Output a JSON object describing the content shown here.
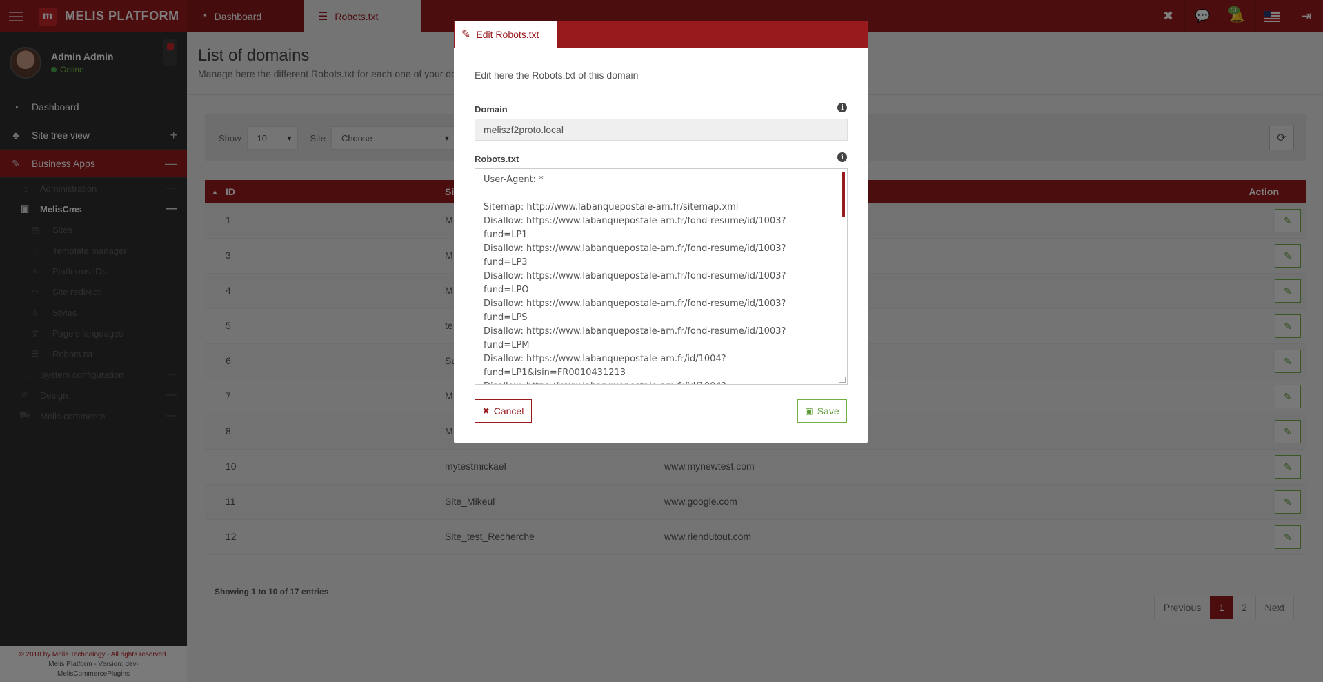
{
  "topbar": {
    "brand": "MELIS PLATFORM",
    "brand_logo": "m",
    "tabs": [
      {
        "label": "Dashboard",
        "icon": "dashboard-icon"
      },
      {
        "label": "Robots.txt",
        "icon": "server-icon"
      }
    ],
    "notification_count": "51"
  },
  "sidebar": {
    "user_name": "Admin Admin",
    "user_status": "Online",
    "items": [
      {
        "label": "Dashboard",
        "icon": "dashboard-icon"
      },
      {
        "label": "Site tree view",
        "icon": "sitemap-icon",
        "toggle": "+"
      },
      {
        "label": "Business Apps",
        "icon": "wrench-icon",
        "toggle": "—"
      }
    ],
    "sub_items": [
      {
        "label": "Administration",
        "icon": "bank-icon",
        "toggle": "—"
      },
      {
        "label": "MelisCms",
        "icon": "id-card-icon",
        "toggle": "—"
      }
    ],
    "cms_items": [
      {
        "label": "Sites",
        "icon": "book-icon"
      },
      {
        "label": "Template manager",
        "icon": "file-icon"
      },
      {
        "label": "Platforms IDs",
        "icon": "list-icon"
      },
      {
        "label": "Site redirect",
        "icon": "share-icon"
      },
      {
        "label": "Styles",
        "icon": "css-icon"
      },
      {
        "label": "Page's languages",
        "icon": "language-icon"
      },
      {
        "label": "Robots.txt",
        "icon": "server-icon"
      }
    ],
    "bottom_items": [
      {
        "label": "System configuration",
        "icon": "sliders-icon",
        "toggle": "—"
      },
      {
        "label": "Design",
        "icon": "brush-icon",
        "toggle": "—"
      },
      {
        "label": "Melis commerce",
        "icon": "cart-icon",
        "toggle": "—"
      }
    ],
    "footer_line1": "© 2018 by Melis Technology - All rights reserved.",
    "footer_line2": "Melis Platform - Version: dev-",
    "footer_line3": "MelisCommercePlugins"
  },
  "main": {
    "title": "List of domains",
    "subtitle": "Manage here the different Robots.txt for each one of your domains",
    "show_label": "Show",
    "show_value": "10",
    "site_label": "Site",
    "site_value": "Choose",
    "columns": {
      "id": "ID",
      "site": "Si",
      "action": "Action"
    },
    "rows": [
      {
        "id": "1",
        "site": "M",
        "domain": ""
      },
      {
        "id": "3",
        "site": "M",
        "domain": ""
      },
      {
        "id": "4",
        "site": "M",
        "domain": ""
      },
      {
        "id": "5",
        "site": "te",
        "domain": ""
      },
      {
        "id": "6",
        "site": "Su",
        "domain": ""
      },
      {
        "id": "7",
        "site": "M",
        "domain": ""
      },
      {
        "id": "8",
        "site": "M",
        "domain": ""
      },
      {
        "id": "10",
        "site": "mytestmickael",
        "domain": "www.mynewtest.com"
      },
      {
        "id": "11",
        "site": "Site_Mikeul",
        "domain": "www.google.com"
      },
      {
        "id": "12",
        "site": "Site_test_Recherche",
        "domain": "www.riendutout.com"
      }
    ],
    "entries_info": "Showing 1 to 10 of 17 entries",
    "pagination": {
      "previous": "Previous",
      "pages": [
        "1",
        "2"
      ],
      "next": "Next"
    }
  },
  "modal": {
    "tab_label": "Edit Robots.txt",
    "intro": "Edit here the Robots.txt of this domain",
    "domain_label": "Domain",
    "domain_value": "meliszf2proto.local",
    "robots_label": "Robots.txt",
    "robots_value": "User-Agent: *\n\nSitemap: http://www.labanquepostale-am.fr/sitemap.xml\nDisallow: https://www.labanquepostale-am.fr/fond-resume/id/1003?fund=LP1\nDisallow: https://www.labanquepostale-am.fr/fond-resume/id/1003?fund=LP3\nDisallow: https://www.labanquepostale-am.fr/fond-resume/id/1003?fund=LPO\nDisallow: https://www.labanquepostale-am.fr/fond-resume/id/1003?fund=LPS\nDisallow: https://www.labanquepostale-am.fr/fond-resume/id/1003?fund=LPM\nDisallow: https://www.labanquepostale-am.fr/id/1004?fund=LP1&isin=FR0010431213\nDisallow: https://www.labanquepostale-am.fr/id/1004?",
    "cancel_label": "Cancel",
    "save_label": "Save"
  },
  "colors": {
    "brand": "#981a1d",
    "success": "#72af46"
  }
}
